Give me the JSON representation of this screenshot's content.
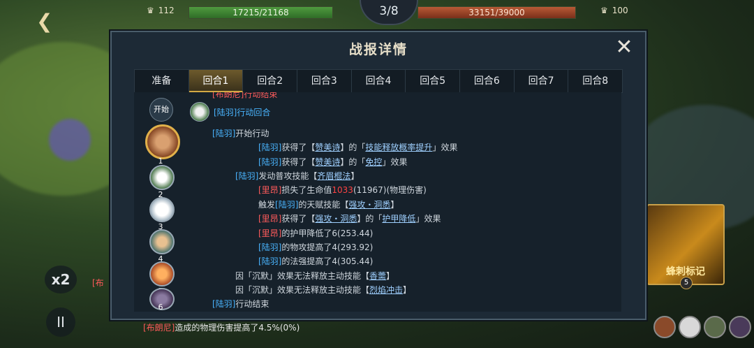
{
  "hud": {
    "left_power": "112",
    "left_hp": "17215/21168",
    "round": "3/8",
    "right_hp": "33151/39000",
    "right_power": "100"
  },
  "controls": {
    "speed_label": "x2",
    "pause_label": "II"
  },
  "background_log": {
    "name_partial": "[布",
    "line1_name": "[布朗尼]",
    "line1_text": "造成的物理伤害提高了4.5%(0%)"
  },
  "skill_card": {
    "label": "蜂刺标记",
    "level": "5"
  },
  "modal": {
    "title": "战报详情",
    "close_glyph": "✕",
    "tabs": [
      "准备",
      "回合1",
      "回合2",
      "回合3",
      "回合4",
      "回合5",
      "回合6",
      "回合7",
      "回合8"
    ],
    "active_tab": "回合1",
    "sidebar": {
      "start_label": "开始",
      "turns": [
        "1",
        "2",
        "3",
        "4",
        "5",
        "6"
      ]
    },
    "entries": {
      "top_cut": "[布朗尼]行动结束",
      "turn_head": "[陆羽]行动回合",
      "lines": [
        {
          "a": "[陆羽]",
          "b": "开始行动"
        },
        {
          "a": "[陆羽]",
          "b": "获得了【",
          "c": "赞美诗",
          "d": "】的「",
          "e": "技能释放概率提升",
          "f": "」效果"
        },
        {
          "a": "[陆羽]",
          "b": "获得了【",
          "c": "赞美诗",
          "d": "】的「",
          "e": "免控",
          "f": "」效果"
        },
        {
          "a": "[陆羽]",
          "b": "发动普攻技能【",
          "c": "齐眉棍法",
          "d": "】"
        },
        {
          "a": "[里昂]",
          "b": "损失了生命值",
          "c": "1033",
          "d": "(11967)(物理伤害)"
        },
        {
          "a": "触发",
          "b": "[陆羽]",
          "c": "的天赋技能【",
          "d": "强攻・洞悉",
          "e": "】"
        },
        {
          "a": "[里昂]",
          "b": "获得了【",
          "c": "强攻・洞悉",
          "d": "】的「",
          "e": "护甲降低",
          "f": "」效果"
        },
        {
          "a": "[里昂]",
          "b": "的护甲降低了6(253.44)"
        },
        {
          "a": "[陆羽]",
          "b": "的物攻提高了4(293.92)"
        },
        {
          "a": "[陆羽]",
          "b": "的法强提高了4(305.44)"
        },
        {
          "a": "因「沉默」效果无法释放主动技能【",
          "b": "香薷",
          "c": "】"
        },
        {
          "a": "因「沉默」效果无法释放主动技能【",
          "b": "烈焰冲击",
          "c": "】"
        },
        {
          "a": "[陆羽]",
          "b": "行动结束"
        }
      ]
    }
  }
}
